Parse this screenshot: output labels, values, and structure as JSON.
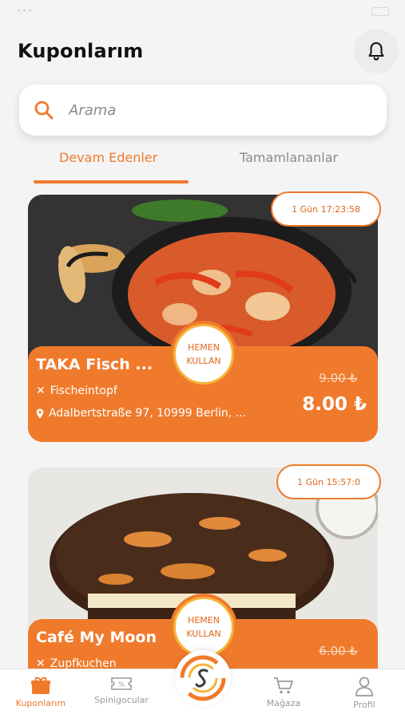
{
  "header": {
    "title": "Kuponlarım"
  },
  "search": {
    "placeholder": "Arama"
  },
  "tabs": [
    {
      "label": "Devam Edenler",
      "active": true
    },
    {
      "label": "Tamamlananlar",
      "active": false
    }
  ],
  "coupons": [
    {
      "name": "TAKA Fisch ...",
      "dish": "Fischeintopf",
      "address": "Adalbertstraße 97, 10999 Berlin, ...",
      "old_price": "9.00 ₺",
      "new_price": "8.00 ₺",
      "timer": "1 Gün 17:23:58",
      "use_line1": "HEMEN",
      "use_line2": "KULLAN"
    },
    {
      "name": "Café My Moon",
      "dish": "Zupfkuchen",
      "old_price": "6.00 ₺",
      "timer": "1 Gün 15:57:0",
      "use_line1": "HEMEN",
      "use_line2": "KULLAN"
    }
  ],
  "bottom_nav": [
    {
      "label": "Kuponlarım",
      "icon": "gift-icon",
      "active": true
    },
    {
      "label": "Spinigocular",
      "icon": "ticket-icon",
      "active": false
    },
    {
      "label": "Mağaza",
      "icon": "cart-icon",
      "active": false
    },
    {
      "label": "Profil",
      "icon": "user-icon",
      "active": false
    }
  ],
  "colors": {
    "accent": "#f07a2c",
    "gold": "#f6b436",
    "background": "#f4f4f4"
  }
}
